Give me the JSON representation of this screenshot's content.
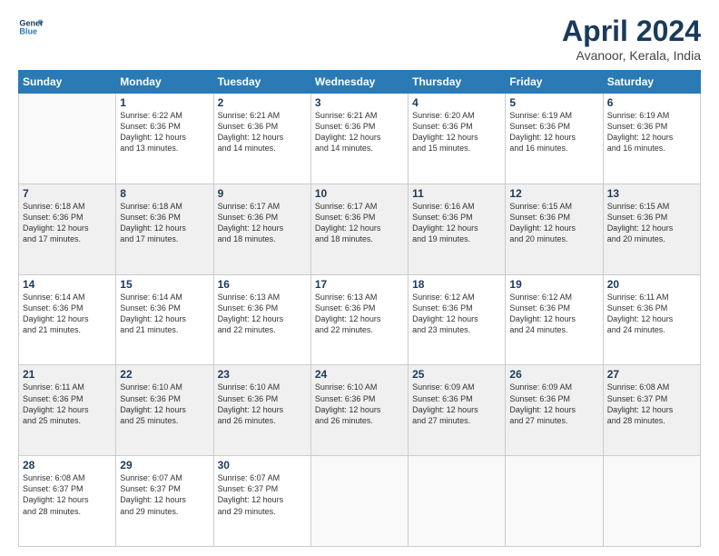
{
  "header": {
    "logo_line1": "General",
    "logo_line2": "Blue",
    "title": "April 2024",
    "location": "Avanoor, Kerala, India"
  },
  "columns": [
    "Sunday",
    "Monday",
    "Tuesday",
    "Wednesday",
    "Thursday",
    "Friday",
    "Saturday"
  ],
  "weeks": [
    [
      {
        "num": "",
        "info": ""
      },
      {
        "num": "1",
        "info": "Sunrise: 6:22 AM\nSunset: 6:36 PM\nDaylight: 12 hours\nand 13 minutes."
      },
      {
        "num": "2",
        "info": "Sunrise: 6:21 AM\nSunset: 6:36 PM\nDaylight: 12 hours\nand 14 minutes."
      },
      {
        "num": "3",
        "info": "Sunrise: 6:21 AM\nSunset: 6:36 PM\nDaylight: 12 hours\nand 14 minutes."
      },
      {
        "num": "4",
        "info": "Sunrise: 6:20 AM\nSunset: 6:36 PM\nDaylight: 12 hours\nand 15 minutes."
      },
      {
        "num": "5",
        "info": "Sunrise: 6:19 AM\nSunset: 6:36 PM\nDaylight: 12 hours\nand 16 minutes."
      },
      {
        "num": "6",
        "info": "Sunrise: 6:19 AM\nSunset: 6:36 PM\nDaylight: 12 hours\nand 16 minutes."
      }
    ],
    [
      {
        "num": "7",
        "info": "Sunrise: 6:18 AM\nSunset: 6:36 PM\nDaylight: 12 hours\nand 17 minutes."
      },
      {
        "num": "8",
        "info": "Sunrise: 6:18 AM\nSunset: 6:36 PM\nDaylight: 12 hours\nand 17 minutes."
      },
      {
        "num": "9",
        "info": "Sunrise: 6:17 AM\nSunset: 6:36 PM\nDaylight: 12 hours\nand 18 minutes."
      },
      {
        "num": "10",
        "info": "Sunrise: 6:17 AM\nSunset: 6:36 PM\nDaylight: 12 hours\nand 18 minutes."
      },
      {
        "num": "11",
        "info": "Sunrise: 6:16 AM\nSunset: 6:36 PM\nDaylight: 12 hours\nand 19 minutes."
      },
      {
        "num": "12",
        "info": "Sunrise: 6:15 AM\nSunset: 6:36 PM\nDaylight: 12 hours\nand 20 minutes."
      },
      {
        "num": "13",
        "info": "Sunrise: 6:15 AM\nSunset: 6:36 PM\nDaylight: 12 hours\nand 20 minutes."
      }
    ],
    [
      {
        "num": "14",
        "info": "Sunrise: 6:14 AM\nSunset: 6:36 PM\nDaylight: 12 hours\nand 21 minutes."
      },
      {
        "num": "15",
        "info": "Sunrise: 6:14 AM\nSunset: 6:36 PM\nDaylight: 12 hours\nand 21 minutes."
      },
      {
        "num": "16",
        "info": "Sunrise: 6:13 AM\nSunset: 6:36 PM\nDaylight: 12 hours\nand 22 minutes."
      },
      {
        "num": "17",
        "info": "Sunrise: 6:13 AM\nSunset: 6:36 PM\nDaylight: 12 hours\nand 22 minutes."
      },
      {
        "num": "18",
        "info": "Sunrise: 6:12 AM\nSunset: 6:36 PM\nDaylight: 12 hours\nand 23 minutes."
      },
      {
        "num": "19",
        "info": "Sunrise: 6:12 AM\nSunset: 6:36 PM\nDaylight: 12 hours\nand 24 minutes."
      },
      {
        "num": "20",
        "info": "Sunrise: 6:11 AM\nSunset: 6:36 PM\nDaylight: 12 hours\nand 24 minutes."
      }
    ],
    [
      {
        "num": "21",
        "info": "Sunrise: 6:11 AM\nSunset: 6:36 PM\nDaylight: 12 hours\nand 25 minutes."
      },
      {
        "num": "22",
        "info": "Sunrise: 6:10 AM\nSunset: 6:36 PM\nDaylight: 12 hours\nand 25 minutes."
      },
      {
        "num": "23",
        "info": "Sunrise: 6:10 AM\nSunset: 6:36 PM\nDaylight: 12 hours\nand 26 minutes."
      },
      {
        "num": "24",
        "info": "Sunrise: 6:10 AM\nSunset: 6:36 PM\nDaylight: 12 hours\nand 26 minutes."
      },
      {
        "num": "25",
        "info": "Sunrise: 6:09 AM\nSunset: 6:36 PM\nDaylight: 12 hours\nand 27 minutes."
      },
      {
        "num": "26",
        "info": "Sunrise: 6:09 AM\nSunset: 6:36 PM\nDaylight: 12 hours\nand 27 minutes."
      },
      {
        "num": "27",
        "info": "Sunrise: 6:08 AM\nSunset: 6:37 PM\nDaylight: 12 hours\nand 28 minutes."
      }
    ],
    [
      {
        "num": "28",
        "info": "Sunrise: 6:08 AM\nSunset: 6:37 PM\nDaylight: 12 hours\nand 28 minutes."
      },
      {
        "num": "29",
        "info": "Sunrise: 6:07 AM\nSunset: 6:37 PM\nDaylight: 12 hours\nand 29 minutes."
      },
      {
        "num": "30",
        "info": "Sunrise: 6:07 AM\nSunset: 6:37 PM\nDaylight: 12 hours\nand 29 minutes."
      },
      {
        "num": "",
        "info": ""
      },
      {
        "num": "",
        "info": ""
      },
      {
        "num": "",
        "info": ""
      },
      {
        "num": "",
        "info": ""
      }
    ]
  ]
}
